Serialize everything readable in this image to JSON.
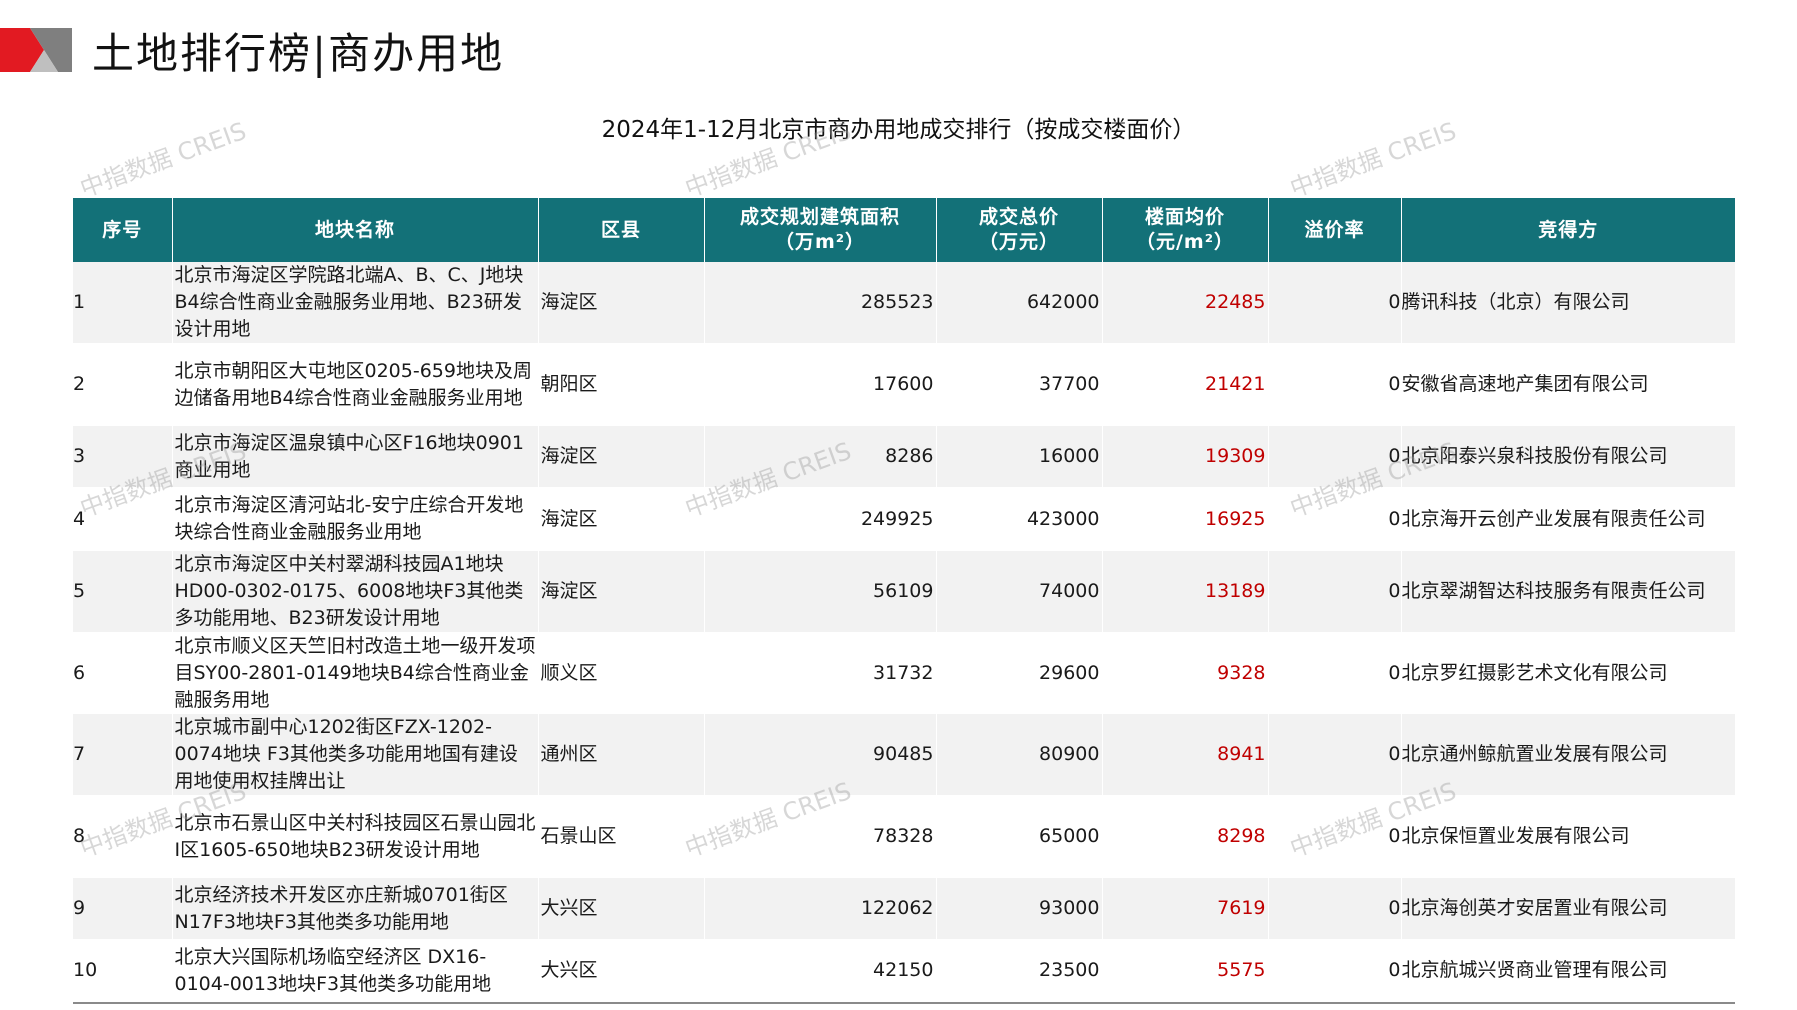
{
  "header": {
    "title": "土地排行榜|商办用地",
    "logo_colors": {
      "red": "#e21a22",
      "gray": "#7f7f7f"
    }
  },
  "watermark": "中指数据 CREIS",
  "table": {
    "title": "2024年1-12月北京市商办用地成交排行（按成交楼面价）",
    "header_bg": "#137178",
    "price_color": "#c00000",
    "columns": [
      "序号",
      "地块名称",
      "区县",
      "成交规划建筑面积\n（万m²）",
      "成交总价\n（万元）",
      "楼面均价\n（元/m²）",
      "溢价率",
      "竞得方"
    ],
    "rows": [
      {
        "seq": "1",
        "name": "北京市海淀区学院路北端A、B、C、J地块B4综合性商业金融服务业用地、B23研发设计用地",
        "district": "海淀区",
        "area": "285523",
        "total": "642000",
        "price": "22485",
        "premium": "0",
        "winner": "腾讯科技（北京）有限公司"
      },
      {
        "seq": "2",
        "name": "北京市朝阳区大屯地区0205-659地块及周边储备用地B4综合性商业金融服务业用地",
        "district": "朝阳区",
        "area": "17600",
        "total": "37700",
        "price": "21421",
        "premium": "0",
        "winner": "安徽省高速地产集团有限公司"
      },
      {
        "seq": "3",
        "name": "北京市海淀区温泉镇中心区F16地块0901商业用地",
        "district": "海淀区",
        "area": "8286",
        "total": "16000",
        "price": "19309",
        "premium": "0",
        "winner": "北京阳泰兴泉科技股份有限公司"
      },
      {
        "seq": "4",
        "name": "北京市海淀区清河站北-安宁庄综合开发地块综合性商业金融服务业用地",
        "district": "海淀区",
        "area": "249925",
        "total": "423000",
        "price": "16925",
        "premium": "0",
        "winner": "北京海开云创产业发展有限责任公司"
      },
      {
        "seq": "5",
        "name": "北京市海淀区中关村翠湖科技园A1地块HD00-0302-0175、6008地块F3其他类多功能用地、B23研发设计用地",
        "district": "海淀区",
        "area": "56109",
        "total": "74000",
        "price": "13189",
        "premium": "0",
        "winner": "北京翠湖智达科技服务有限责任公司"
      },
      {
        "seq": "6",
        "name": "北京市顺义区天竺旧村改造土地一级开发项目SY00-2801-0149地块B4综合性商业金融服务用地",
        "district": "顺义区",
        "area": "31732",
        "total": "29600",
        "price": "9328",
        "premium": "0",
        "winner": "北京罗红摄影艺术文化有限公司"
      },
      {
        "seq": "7",
        "name": "北京城市副中心1202街区FZX-1202-0074地块 F3其他类多功能用地国有建设用地使用权挂牌出让",
        "district": "通州区",
        "area": "90485",
        "total": "80900",
        "price": "8941",
        "premium": "0",
        "winner": "北京通州鲸航置业发展有限公司"
      },
      {
        "seq": "8",
        "name": "北京市石景山区中关村科技园区石景山园北Ⅰ区1605-650地块B23研发设计用地",
        "district": "石景山区",
        "area": "78328",
        "total": "65000",
        "price": "8298",
        "premium": "0",
        "winner": "北京保恒置业发展有限公司"
      },
      {
        "seq": "9",
        "name": "北京经济技术开发区亦庄新城0701街区 N17F3地块F3其他类多功能用地",
        "district": "大兴区",
        "area": "122062",
        "total": "93000",
        "price": "7619",
        "premium": "0",
        "winner": "北京海创英才安居置业有限公司"
      },
      {
        "seq": "10",
        "name": "北京大兴国际机场临空经济区 DX16-0104-0013地块F3其他类多功能用地",
        "district": "大兴区",
        "area": "42150",
        "total": "23500",
        "price": "5575",
        "premium": "0",
        "winner": "北京航城兴贤商业管理有限公司"
      }
    ]
  }
}
